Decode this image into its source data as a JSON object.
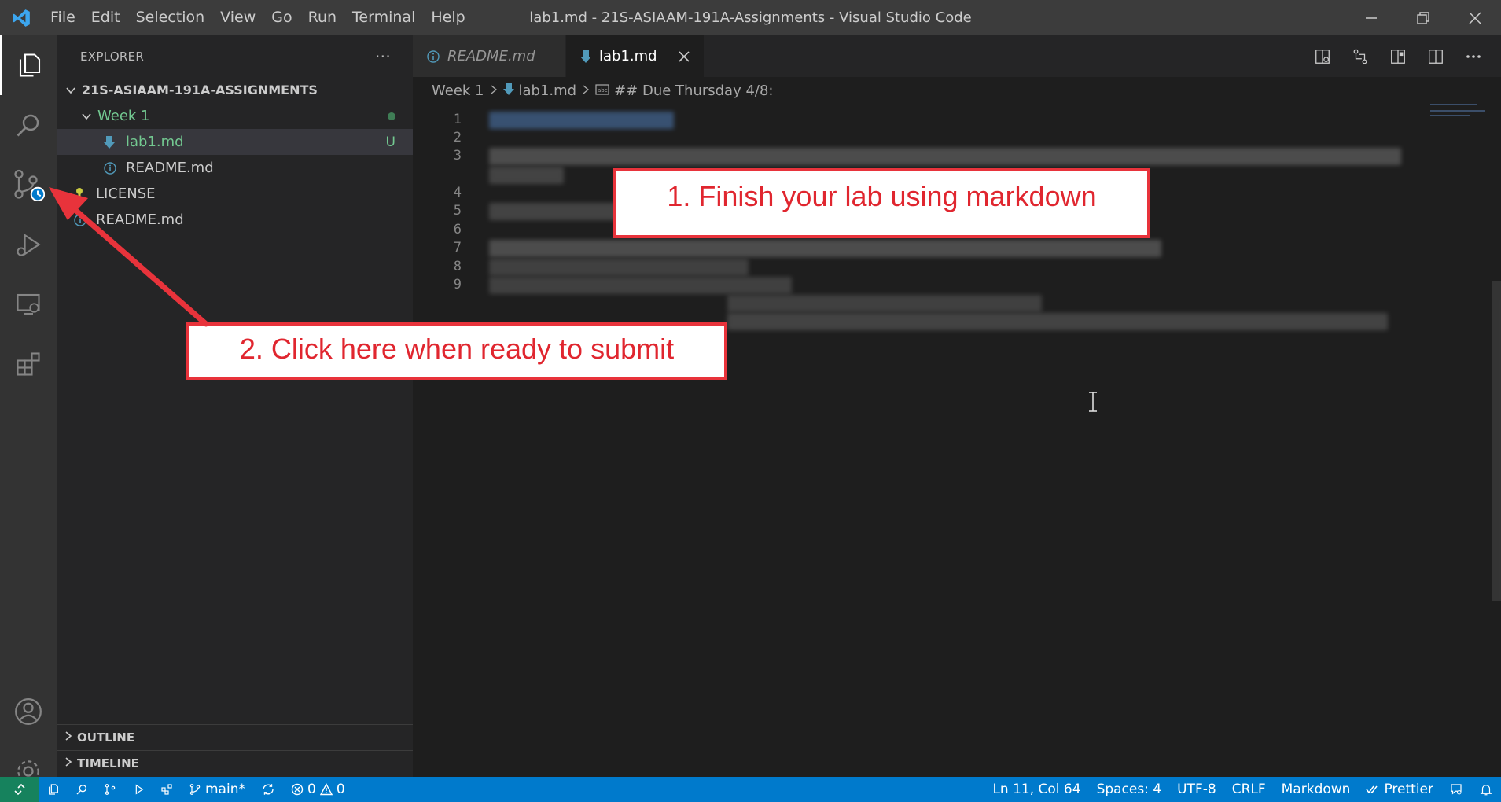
{
  "titlebar": {
    "menu": [
      "File",
      "Edit",
      "Selection",
      "View",
      "Go",
      "Run",
      "Terminal",
      "Help"
    ],
    "window_title": "lab1.md - 21S-ASIAAM-191A-Assignments - Visual Studio Code"
  },
  "activity_bar": {
    "items": [
      "explorer-icon",
      "search-icon",
      "source-control-icon",
      "run-debug-icon",
      "remote-explorer-icon",
      "extensions-icon"
    ],
    "bottom": [
      "accounts-icon",
      "manage-gear-icon"
    ]
  },
  "sidebar": {
    "title": "EXPLORER",
    "more_label": "···",
    "root_folder": "21S-ASIAAM-191A-ASSIGNMENTS",
    "tree": [
      {
        "label": "Week 1",
        "kind": "folder",
        "color": "#73c991"
      },
      {
        "label": "lab1.md",
        "kind": "file",
        "status": "U",
        "color": "#73c991"
      },
      {
        "label": "README.md",
        "kind": "file",
        "color": "#cccccc"
      },
      {
        "label": "LICENSE",
        "kind": "file",
        "color": "#cccccc"
      },
      {
        "label": "README.md",
        "kind": "file",
        "color": "#cccccc"
      }
    ],
    "outline_label": "OUTLINE",
    "timeline_label": "TIMELINE"
  },
  "tabs": [
    {
      "label": "README.md",
      "active": false
    },
    {
      "label": "lab1.md",
      "active": true
    }
  ],
  "breadcrumb": {
    "folder": "Week 1",
    "file": "lab1.md",
    "symbol": "## Due Thursday 4/8:"
  },
  "editor": {
    "line_numbers": [
      "1",
      "2",
      "3",
      "4",
      "5",
      "6",
      "7",
      "8",
      "9"
    ]
  },
  "callouts": {
    "step1": "1. Finish your lab using markdown",
    "step2": "2. Click here when ready to submit"
  },
  "statusbar": {
    "branch": "main*",
    "errors": "0",
    "warnings": "0",
    "position": "Ln 11, Col 64",
    "spaces": "Spaces: 4",
    "encoding": "UTF-8",
    "eol": "CRLF",
    "language": "Markdown",
    "prettier": "Prettier"
  },
  "colors": {
    "accent": "#007acc",
    "callout_red": "#e8333b",
    "git_untracked": "#73c991"
  }
}
